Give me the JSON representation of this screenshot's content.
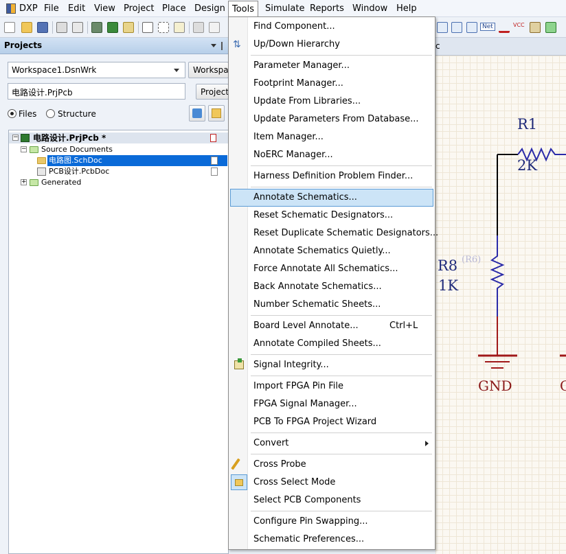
{
  "menubar": {
    "dxp": "DXP",
    "items": [
      "File",
      "Edit",
      "View",
      "Project",
      "Place",
      "Design",
      "Tools",
      "Simulate",
      "Reports",
      "Window",
      "Help"
    ]
  },
  "projects_panel": {
    "title": "Projects",
    "workspace_select": "Workspace1.DsnWrk",
    "workspace_button": "Workspace",
    "project_field": "电路设计.PrjPcb",
    "project_button": "Project",
    "radio_files": "Files",
    "radio_structure": "Structure",
    "tree": {
      "project": "电路设计.PrjPcb *",
      "source_folder": "Source Documents",
      "sch_doc": "电路图.SchDoc",
      "pcb_doc": "PCB设计.PcbDoc",
      "generated": "Generated"
    }
  },
  "tools_menu": {
    "items": [
      {
        "label": "Find Component...",
        "shortcut": ""
      },
      {
        "label": "Up/Down Hierarchy",
        "shortcut": ""
      },
      {
        "label": "Parameter Manager...",
        "shortcut": ""
      },
      {
        "label": "Footprint Manager...",
        "shortcut": ""
      },
      {
        "label": "Update From Libraries...",
        "shortcut": ""
      },
      {
        "label": "Update Parameters From Database...",
        "shortcut": ""
      },
      {
        "label": "Item Manager...",
        "shortcut": ""
      },
      {
        "label": "NoERC Manager...",
        "shortcut": ""
      },
      {
        "label": "Harness Definition Problem Finder...",
        "shortcut": ""
      },
      {
        "label": "Annotate Schematics...",
        "shortcut": ""
      },
      {
        "label": "Reset Schematic Designators...",
        "shortcut": ""
      },
      {
        "label": "Reset Duplicate Schematic Designators...",
        "shortcut": ""
      },
      {
        "label": "Annotate Schematics Quietly...",
        "shortcut": ""
      },
      {
        "label": "Force Annotate All Schematics...",
        "shortcut": ""
      },
      {
        "label": "Back Annotate Schematics...",
        "shortcut": ""
      },
      {
        "label": "Number Schematic Sheets...",
        "shortcut": ""
      },
      {
        "label": "Board Level Annotate...",
        "shortcut": "Ctrl+L"
      },
      {
        "label": "Annotate Compiled Sheets...",
        "shortcut": ""
      },
      {
        "label": "Signal Integrity...",
        "shortcut": ""
      },
      {
        "label": "Import FPGA Pin File",
        "shortcut": ""
      },
      {
        "label": "FPGA Signal Manager...",
        "shortcut": ""
      },
      {
        "label": "PCB To FPGA Project Wizard",
        "shortcut": ""
      },
      {
        "label": "Convert",
        "shortcut": ""
      },
      {
        "label": "Cross Probe",
        "shortcut": ""
      },
      {
        "label": "Cross Select Mode",
        "shortcut": ""
      },
      {
        "label": "Select PCB Components",
        "shortcut": ""
      },
      {
        "label": "Configure Pin Swapping...",
        "shortcut": ""
      },
      {
        "label": "Schematic Preferences...",
        "shortcut": ""
      }
    ]
  },
  "schematic": {
    "r1_designator": "R1",
    "r1_value": "2K",
    "r8_designator": "R8",
    "r8_original": "(R6)",
    "r8_value": "1K",
    "gnd_label": "GND",
    "gnd_label_partial": "G",
    "doc_tab_partial": "c"
  },
  "colors": {
    "highlight": "#cce4f7",
    "schematic_text": "#1f2a7a",
    "gnd_text": "#8b1a1a",
    "resistor": "#2a2aa8",
    "power": "#a01818"
  }
}
